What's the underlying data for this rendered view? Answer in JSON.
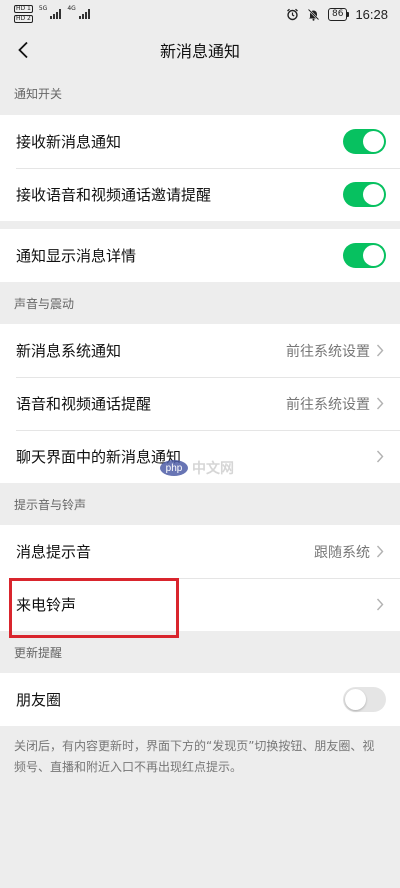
{
  "status_bar": {
    "sim1": "HD 1",
    "sim2": "HD 2",
    "net1": "5G",
    "net2": "4G",
    "battery": "86",
    "time": "16:28"
  },
  "nav": {
    "title": "新消息通知"
  },
  "sections": {
    "notify_switch": "通知开关",
    "sound_vibration": "声音与震动",
    "tone_ringtone": "提示音与铃声",
    "update_reminder": "更新提醒"
  },
  "rows": {
    "receive_new": "接收新消息通知",
    "receive_call_invite": "接收语音和视频通话邀请提醒",
    "show_details": "通知显示消息详情",
    "new_msg_system": "新消息系统通知",
    "new_msg_system_value": "前往系统设置",
    "call_reminder": "语音和视频通话提醒",
    "call_reminder_value": "前往系统设置",
    "chat_new_msg": "聊天界面中的新消息通知",
    "msg_tone": "消息提示音",
    "msg_tone_value": "跟随系统",
    "ringtone": "来电铃声",
    "moments": "朋友圈"
  },
  "toggles": {
    "receive_new": true,
    "receive_call_invite": true,
    "show_details": true,
    "moments": false
  },
  "footer_note": "关闭后，有内容更新时，界面下方的“发现页”切换按钮、朋友圈、视频号、直播和附近入口不再出现红点提示。",
  "watermark": {
    "logo": "php",
    "text": "中文网"
  },
  "colors": {
    "accent": "#07c160",
    "highlight": "#d9252d",
    "background": "#ededed"
  }
}
